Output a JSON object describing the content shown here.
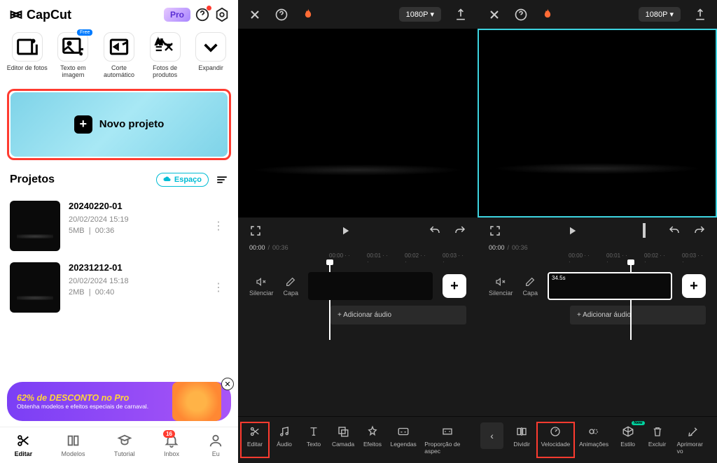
{
  "panel1": {
    "app_name": "CapCut",
    "pro_badge": "Pro",
    "tools": [
      {
        "label": "Editor de fotos",
        "icon": "photo-editor-icon"
      },
      {
        "label": "Texto em imagem",
        "icon": "text-image-icon",
        "free": "Free"
      },
      {
        "label": "Corte automático",
        "icon": "auto-cut-icon"
      },
      {
        "label": "Fotos de produtos",
        "icon": "product-photo-icon"
      },
      {
        "label": "Expandir",
        "icon": "expand-icon"
      }
    ],
    "new_project": "Novo projeto",
    "projects_header": "Projetos",
    "cloud_btn": "Espaço",
    "projects": [
      {
        "name": "20240220-01",
        "date": "20/02/2024 15:19",
        "size": "5MB",
        "dur": "00:36"
      },
      {
        "name": "20231212-01",
        "date": "20/02/2024 15:18",
        "size": "2MB",
        "dur": "00:40"
      }
    ],
    "promo": {
      "line1": "62% de DESCONTO no Pro",
      "line2": "Obtenha modelos e efeitos especiais de carnaval."
    },
    "nav": [
      {
        "label": "Editar",
        "icon": "scissors-icon",
        "active": true
      },
      {
        "label": "Modelos",
        "icon": "templates-icon"
      },
      {
        "label": "Tutorial",
        "icon": "tutorial-icon"
      },
      {
        "label": "Inbox",
        "icon": "bell-icon",
        "badge": "16"
      },
      {
        "label": "Eu",
        "icon": "profile-icon"
      }
    ]
  },
  "editor": {
    "resolution": "1080P",
    "time_current": "00:00",
    "time_total": "00:36",
    "ruler": [
      "00:00",
      "00:01",
      "00:02",
      "00:03"
    ],
    "clip_duration": "34.5s",
    "mute_label": "Silenciar",
    "cover_label": "Capa",
    "add_audio": "+  Adicionar áudio",
    "tools_a": [
      {
        "label": "Editar",
        "icon": "scissors-icon",
        "hl": true
      },
      {
        "label": "Áudio",
        "icon": "audio-icon"
      },
      {
        "label": "Texto",
        "icon": "text-icon"
      },
      {
        "label": "Camada",
        "icon": "overlay-icon"
      },
      {
        "label": "Efeitos",
        "icon": "effects-icon"
      },
      {
        "label": "Legendas",
        "icon": "captions-icon"
      },
      {
        "label": "Proporção de aspec",
        "icon": "ratio-icon"
      }
    ],
    "tools_b": [
      {
        "label": "Dividir",
        "icon": "split-icon"
      },
      {
        "label": "Velocidade",
        "icon": "speed-icon",
        "hl": true
      },
      {
        "label": "Animações",
        "icon": "anim-icon"
      },
      {
        "label": "Estilo",
        "icon": "style-icon",
        "new": "New"
      },
      {
        "label": "Excluir",
        "icon": "delete-icon"
      },
      {
        "label": "Aprimorar vo",
        "icon": "enhance-icon"
      }
    ]
  }
}
